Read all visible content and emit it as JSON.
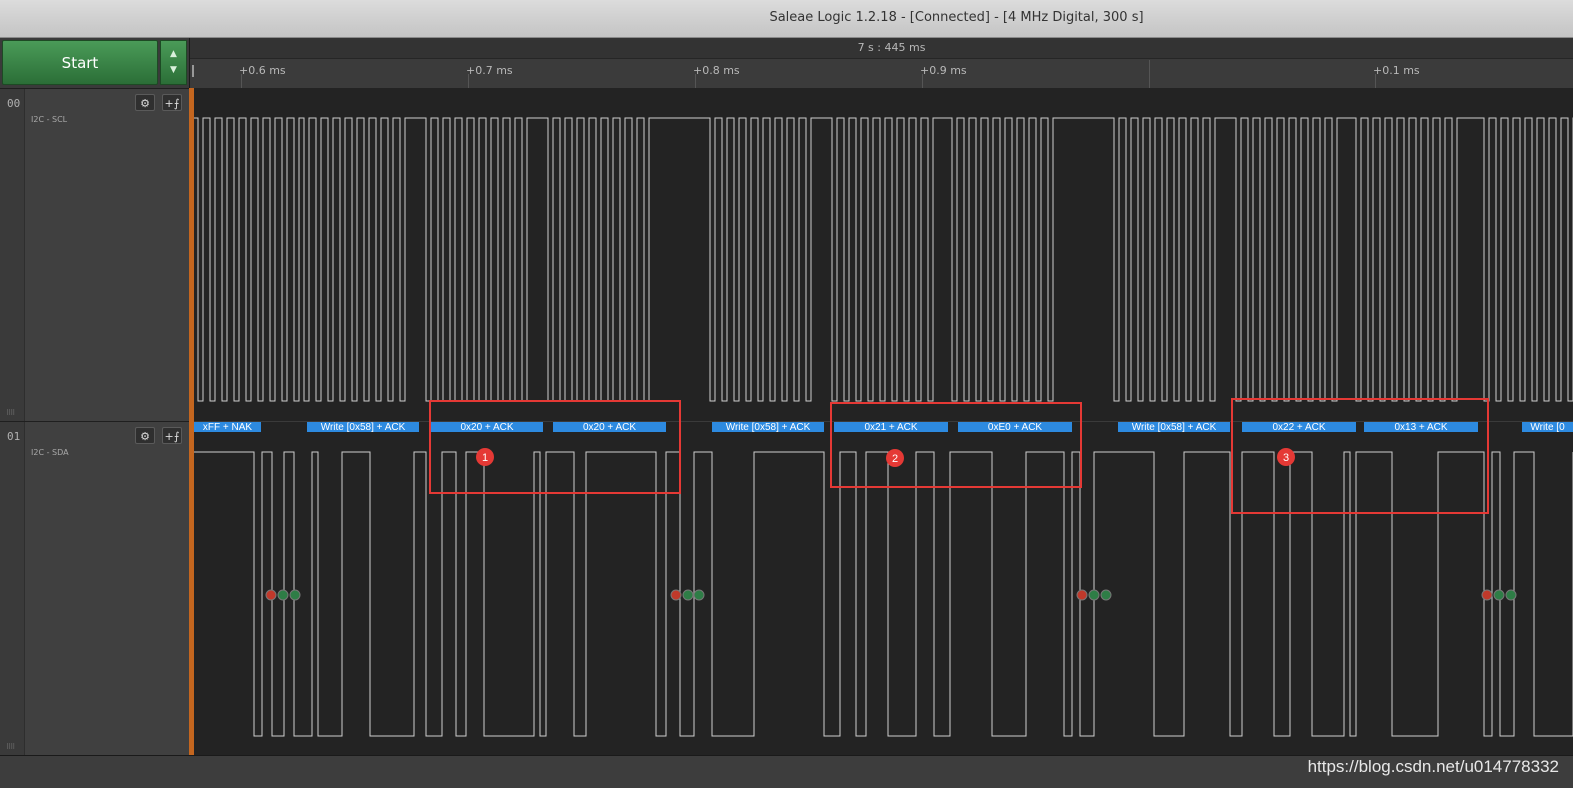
{
  "window": {
    "title": "Saleae Logic 1.2.18 - [Connected] - [4 MHz Digital, 300 s]"
  },
  "toolbar": {
    "start_label": "Start",
    "up_arrow": "▲",
    "down_arrow": "▼"
  },
  "ruler": {
    "absolute_time": "7 s : 445 ms",
    "ticks": [
      "+0.6 ms",
      "+0.7 ms",
      "+0.8 ms",
      "+0.9 ms",
      "+0.1 ms"
    ]
  },
  "channels": [
    {
      "number": "00",
      "label": "I2C - SCL",
      "settings_icon": "⚙",
      "trigger_icon": "+⨍",
      "grip": "⠿⠿"
    },
    {
      "number": "01",
      "label": "I2C - SDA",
      "settings_icon": "⚙",
      "trigger_icon": "+⨍",
      "grip": "⠿⠿"
    }
  ],
  "decoder_frames": [
    "xFF + NAK",
    "Write [0x58] + ACK",
    "0x20 + ACK",
    "0x20 + ACK",
    "Write [0x58] + ACK",
    "0x21 + ACK",
    "0xE0 + ACK",
    "Write [0x58] + ACK",
    "0x22 + ACK",
    "0x13 + ACK",
    "Write [0"
  ],
  "callouts": [
    "1",
    "2",
    "3"
  ],
  "colors": {
    "decoder": "#2d8ae0",
    "highlight": "#e53935",
    "start_green": "#3c8a48",
    "marker_orange": "#c4661f"
  },
  "watermark": "https://blog.csdn.net/u014778332"
}
